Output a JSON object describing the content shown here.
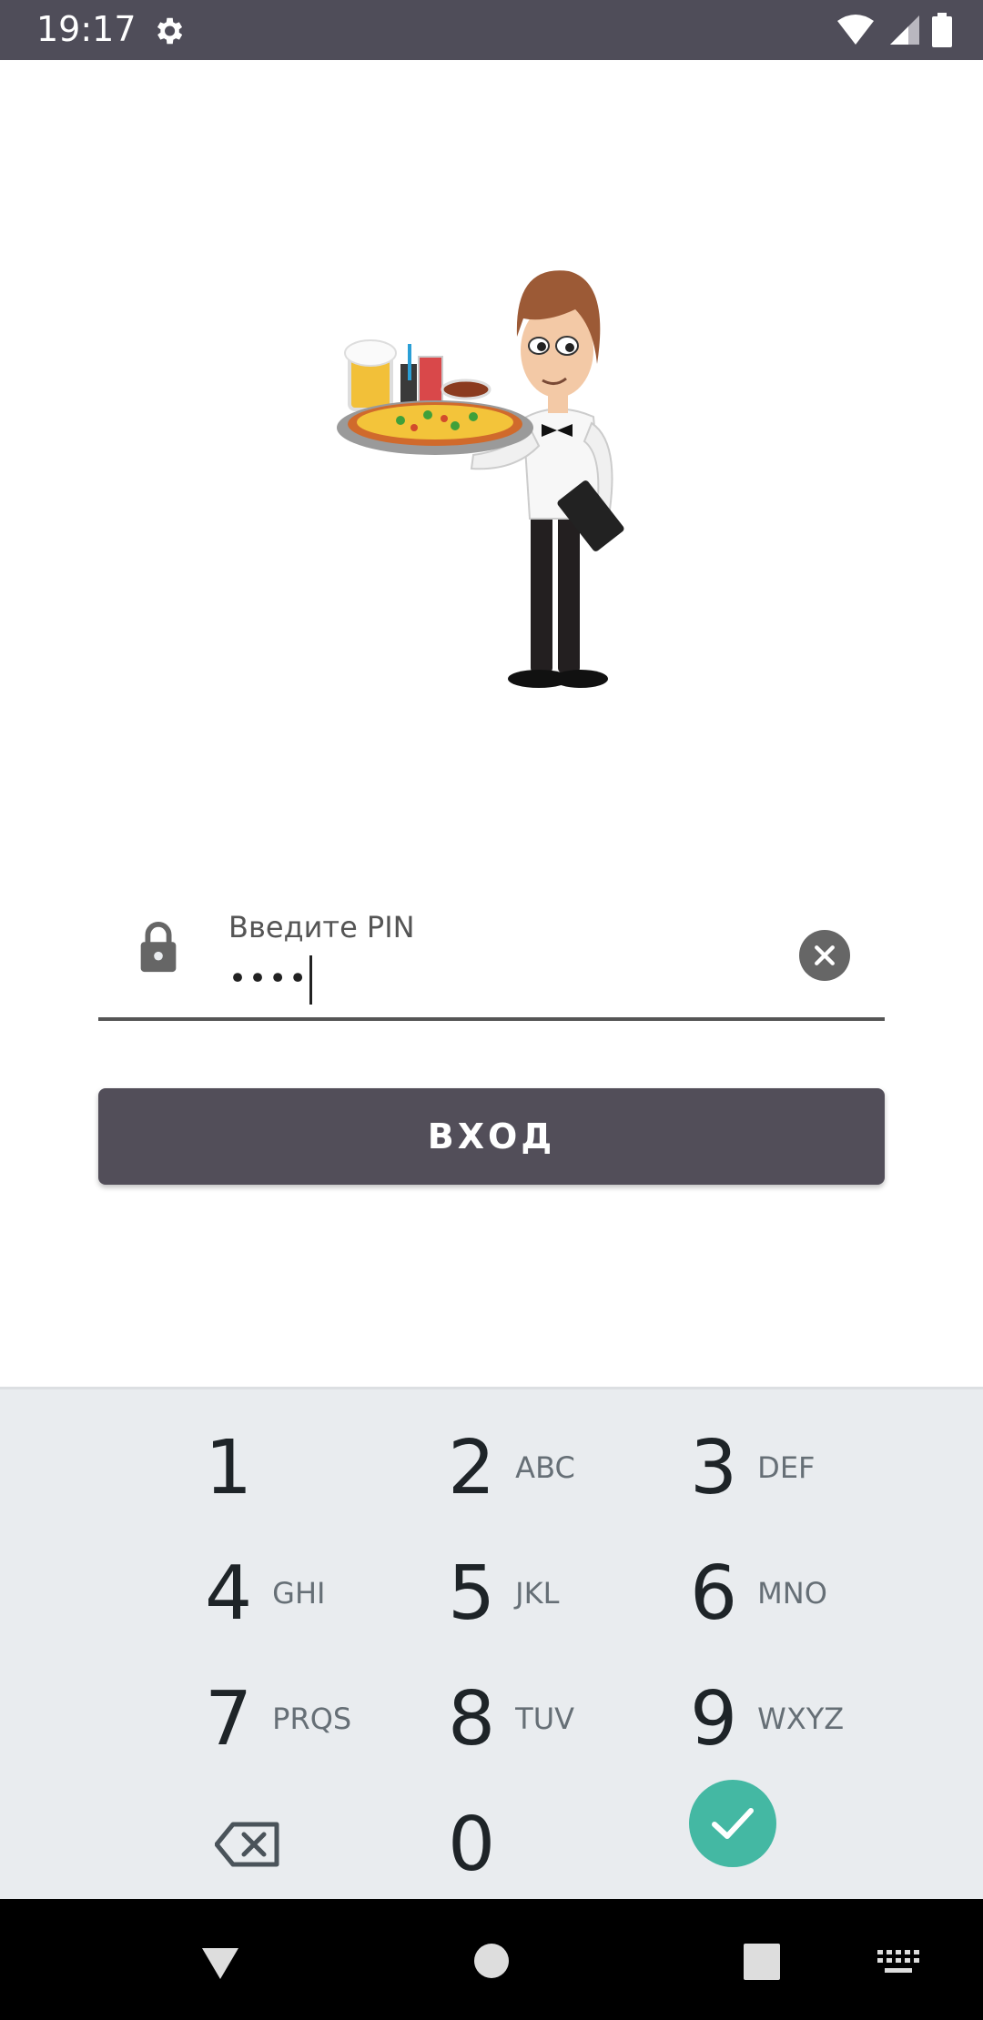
{
  "status_bar": {
    "time": "19:17"
  },
  "login": {
    "pin_label": "Введите PIN",
    "pin_value": "••••",
    "submit_label": "ВХОД"
  },
  "keypad": {
    "keys": [
      {
        "digit": "1",
        "letters": ""
      },
      {
        "digit": "2",
        "letters": "ABC"
      },
      {
        "digit": "3",
        "letters": "DEF"
      },
      {
        "digit": "4",
        "letters": "GHI"
      },
      {
        "digit": "5",
        "letters": "JKL"
      },
      {
        "digit": "6",
        "letters": "MNO"
      },
      {
        "digit": "7",
        "letters": "PRQS"
      },
      {
        "digit": "8",
        "letters": "TUV"
      },
      {
        "digit": "9",
        "letters": "WXYZ"
      },
      {
        "digit": "0",
        "letters": ""
      }
    ]
  },
  "icons": {
    "status": [
      "settings-gear-icon",
      "wifi-icon",
      "cell-signal-icon",
      "battery-icon"
    ],
    "field": [
      "lock-icon",
      "clear-icon"
    ],
    "keypad": [
      "backspace-icon",
      "done-check-icon"
    ],
    "navigation": [
      "back-icon",
      "home-icon",
      "recents-icon",
      "keyboard-icon"
    ]
  },
  "colors": {
    "status_bar": "#4f4d59",
    "button": "#524e59",
    "keypad_bg": "#e9ecef",
    "done": "#44b8a3"
  }
}
